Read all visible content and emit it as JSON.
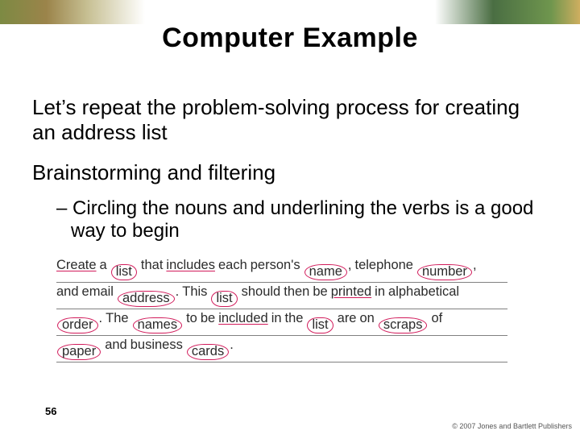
{
  "slide": {
    "title": "Computer Example",
    "page_number": "56",
    "copyright": "© 2007 Jones and Bartlett Publishers"
  },
  "content": {
    "intro": "Let’s repeat the problem-solving process for creating an address list",
    "section": "Brainstorming and filtering",
    "bullet_dash": "–",
    "bullet_text": "Circling the nouns and underlining the verbs is a good way to begin"
  },
  "quote": {
    "w": {
      "create": "Create",
      "a": "a",
      "list": "list",
      "that": "that",
      "includes": "includes",
      "each": "each",
      "persons": "person's",
      "name": "name",
      "comma": ",",
      "telephone": "telephone",
      "number": "number",
      "and": "and",
      "email": "email",
      "address": "address",
      "period": ".",
      "this": "This",
      "list2": "list",
      "should": "should",
      "then": "then",
      "be": "be",
      "printed": "printed",
      "in": "in",
      "alphabetical": "alphabetical",
      "order": "order",
      "the": "The",
      "names": "names",
      "to": "to",
      "be2": "be",
      "included": "included",
      "in2": "in",
      "the2": "the",
      "list3": "list",
      "are": "are",
      "on": "on",
      "scraps": "scraps",
      "of": "of",
      "paper": "paper",
      "and2": "and",
      "business": "business",
      "cards": "cards"
    }
  }
}
